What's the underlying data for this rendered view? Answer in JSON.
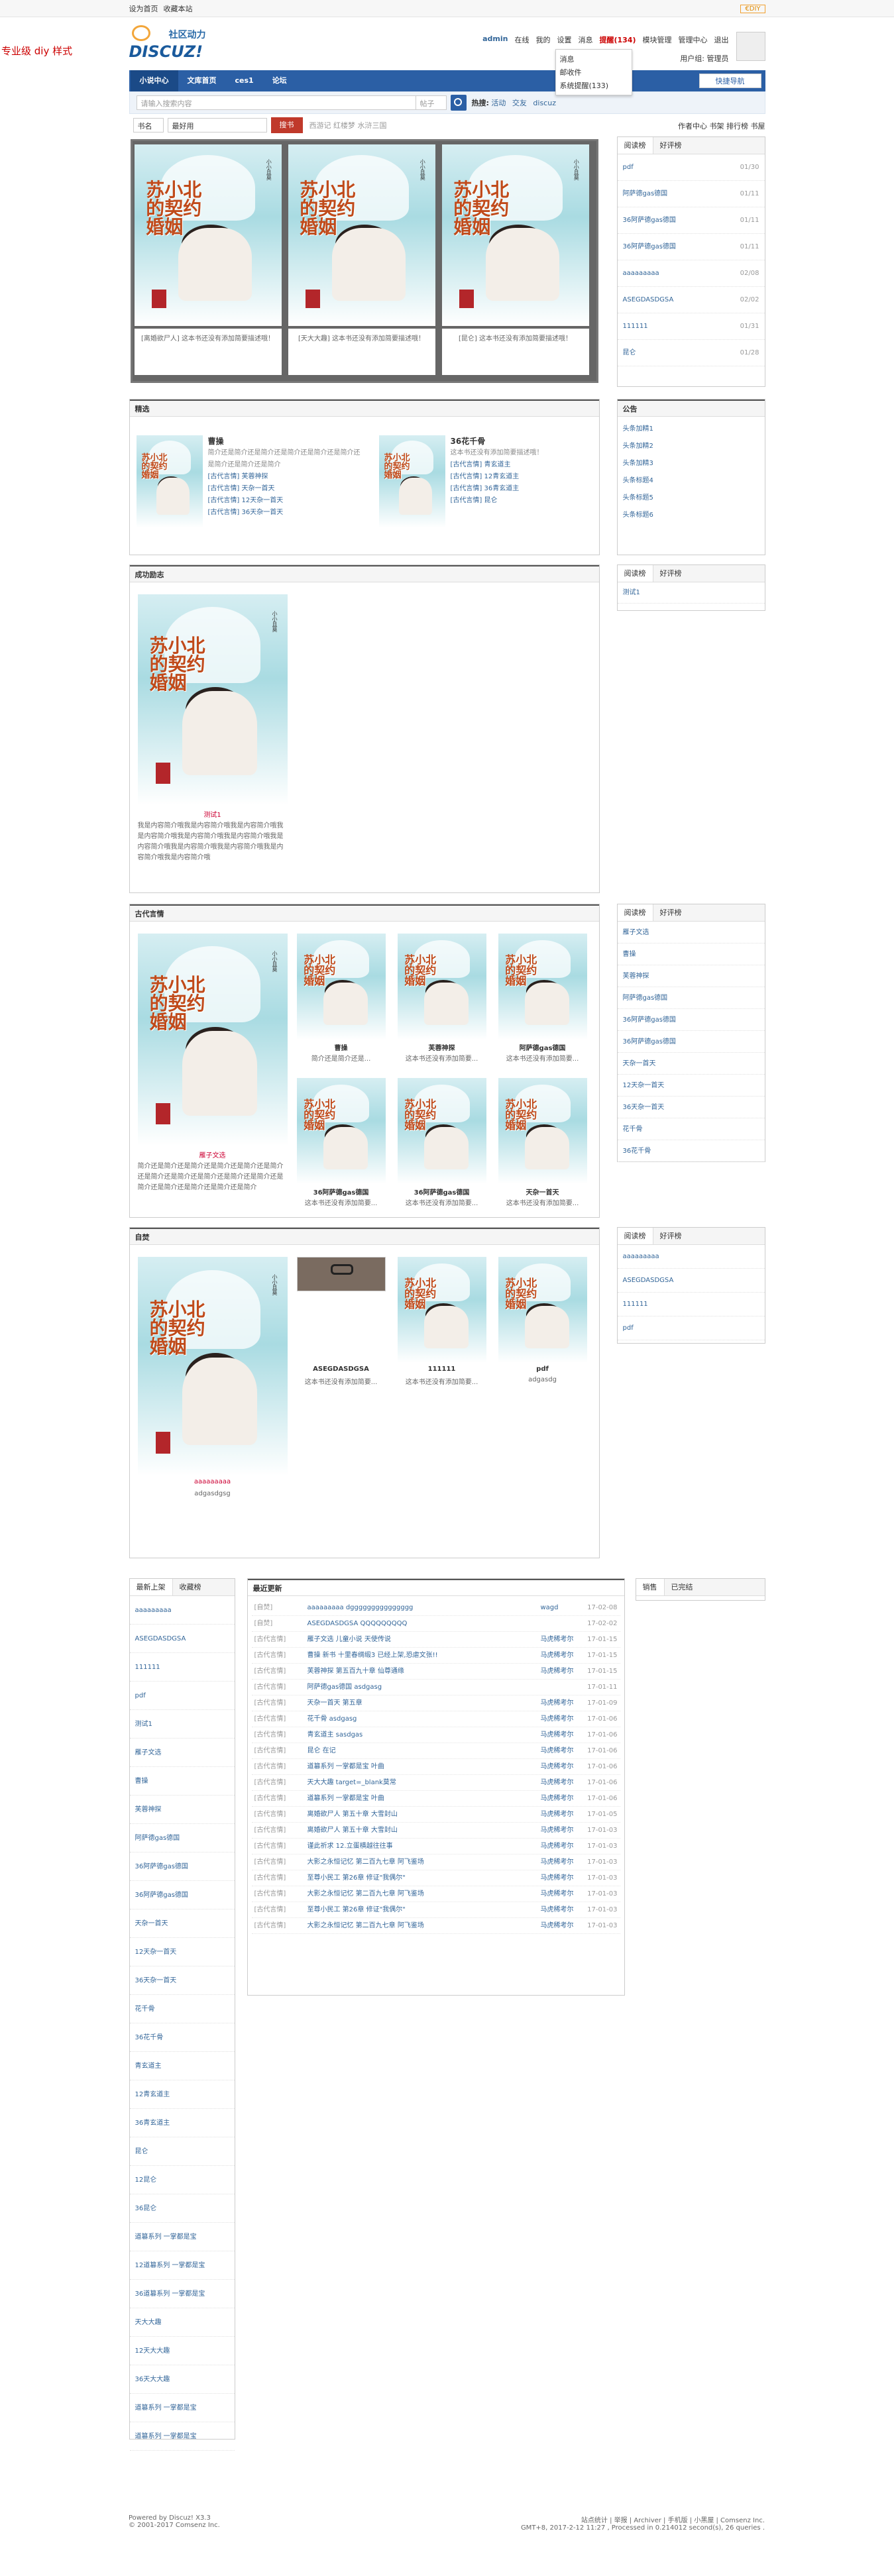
{
  "topbar": {
    "left": [
      "设为首页",
      "收藏本站"
    ],
    "right_badge": "€DIY"
  },
  "side_brand": "专业级 diy 样式",
  "logo": {
    "line1": "社区动力",
    "line2": "DISCUZ!"
  },
  "user_menu": {
    "items": [
      "admin",
      "在线",
      "我的",
      "设置",
      "消息",
      "提醒(134)",
      "模块管理",
      "管理中心",
      "退出"
    ],
    "line2": "用户组: 管理员"
  },
  "dropdown": {
    "items": [
      "消息",
      "邮收件",
      "系统提醒(133)"
    ]
  },
  "nav": {
    "items": [
      "小说中心",
      "文库首页",
      "ces1",
      "论坛"
    ],
    "quick": "快捷导航"
  },
  "search": {
    "placeholder": "请输入搜索内容",
    "scope": "帖子",
    "hot_label": "热搜:",
    "hot": [
      "活动",
      "交友",
      "discuz"
    ]
  },
  "bar2": {
    "field1": "书名",
    "field2": "最好用",
    "button": "搜书",
    "hints": "西游记 红楼梦 水浒三国",
    "right": "作者中心 书架 排行榜 书屋"
  },
  "slider": {
    "captions": [
      "[离婚欲尸人] 这本书还没有添加简要描述哦！",
      "[天大大趣] 这本书还没有添加简要描述哦！",
      "[昆仑] 这本书还没有添加简要描述哦！"
    ]
  },
  "rank1": {
    "tabs": [
      "阅读榜",
      "好评榜"
    ],
    "rows": [
      [
        "pdf",
        "01/30"
      ],
      [
        "阿萨德gas德国",
        "01/11"
      ],
      [
        "36阿萨德gas德国",
        "01/11"
      ],
      [
        "36阿萨德gas德国",
        "01/11"
      ],
      [
        "aaaaaaaaa",
        "02/08"
      ],
      [
        "ASEGDASDGSA",
        "02/02"
      ],
      [
        "111111",
        "01/31"
      ],
      [
        "昆仑",
        "01/28"
      ]
    ]
  },
  "featured": {
    "title": "精选",
    "books": [
      {
        "name": "曹操",
        "desc": "简介还是简介还是简介还是简介还是简介还是简介还是简介还是简介还是简介",
        "lines": [
          "[古代言情] 芙蓉神探",
          "[古代言情] 天杂一首天",
          "[古代言情] 12天杂一首天",
          "[古代言情] 36天杂一首天"
        ]
      },
      {
        "name": "36花千骨",
        "desc": "这本书还没有添加简要描述哦！",
        "lines": [
          "[古代言情] 青玄道主",
          "[古代言情] 12青玄道主",
          "[古代言情] 36青玄道主",
          "[古代言情] 昆仑"
        ]
      }
    ]
  },
  "notice": {
    "title": "公告",
    "items": [
      "头条加精1",
      "头条加精2",
      "头条加精3",
      "头条标题4",
      "头条标题5",
      "头条标题6"
    ]
  },
  "rank2": {
    "tabs": [
      "阅读榜",
      "好评榜"
    ],
    "rows": [
      [
        "测试1",
        ""
      ]
    ]
  },
  "success": {
    "title": "成功励志",
    "book": "测试1",
    "desc": "我是内容简介哦我是内容简介哦我是内容简介哦我是内容简介哦我是内容简介哦我是内容简介哦我是内容简介哦我是内容简介哦我是内容简介哦我是内容简介哦我是内容简介哦"
  },
  "ancient": {
    "title": "古代言情",
    "main": {
      "name": "雁子文选",
      "desc": "简介还是简介还是简介还是简介还是简介还是简介还是简介还是简介还是简介还是简介还是简介还是简介还是简介还是简介还是简介还是简介"
    },
    "grid": [
      [
        "曹操",
        "简介还是简介还是..."
      ],
      [
        "芙蓉神探",
        "这本书还没有添加简要..."
      ],
      [
        "阿萨德gas德国",
        "这本书还没有添加简要..."
      ],
      [
        "36阿萨德gas德国",
        "这本书还没有添加简要..."
      ],
      [
        "36阿萨德gas德国",
        "这本书还没有添加简要..."
      ],
      [
        "天杂一首天",
        "这本书还没有添加简要..."
      ]
    ]
  },
  "rank3": {
    "tabs": [
      "阅读榜",
      "好评榜"
    ],
    "rows": [
      "雁子文选",
      "曹操",
      "芙蓉神探",
      "阿萨德gas德国",
      "36阿萨德gas德国",
      "36阿萨德gas德国",
      "天杂一首天",
      "12天杂一首天",
      "36天杂一首天",
      "花千骨",
      "36花千骨"
    ]
  },
  "zibin": {
    "title": "自焚",
    "main": {
      "name": "aaaaaaaaa",
      "desc": "adgasdgsg"
    },
    "grid": [
      [
        "ASEGDASDGSA",
        "这本书还没有添加简要..."
      ],
      [
        "111111",
        "这本书还没有添加简要..."
      ],
      [
        "pdf",
        "adgasdg"
      ]
    ]
  },
  "rank4": {
    "tabs": [
      "阅读榜",
      "好评榜"
    ],
    "rows": [
      "aaaaaaaaa",
      "ASEGDASDGSA",
      "111111",
      "pdf"
    ]
  },
  "newbooks": {
    "tabs": [
      "最新上架",
      "收藏榜"
    ],
    "items": [
      "aaaaaaaaa",
      "ASEGDASDGSA",
      "111111",
      "pdf",
      "测试1",
      "雁子文选",
      "曹操",
      "芙蓉神探",
      "阿萨德gas德国",
      "36阿萨德gas德国",
      "36阿萨德gas德国",
      "天杂一首天",
      "12天杂一首天",
      "36天杂一首天",
      "花千骨",
      "36花千骨",
      "青玄道主",
      "12青玄道主",
      "36青玄道主",
      "昆仑",
      "12昆仑",
      "36昆仑",
      "道篡系列 一掌都是宝",
      "12道篡系列 一掌都是宝",
      "36道篡系列 一掌都是宝",
      "天大大趣",
      "12天大大趣",
      "36天大大趣",
      "道篡系列 一掌都是宝",
      "道篡系列 一掌都是宝"
    ]
  },
  "recent": {
    "title": "最近更新",
    "rows": [
      [
        "[自焚]",
        "aaaaaaaaa dggggggggggggggg",
        "wagd",
        "17-02-08"
      ],
      [
        "[自焚]",
        "ASEGDASDGSA QQQQQQQQQ",
        "",
        "17-02-02"
      ],
      [
        "[古代言情]",
        "雁子文选 儿童小说 天使传说",
        "马虎稀考尔",
        "17-01-15"
      ],
      [
        "[古代言情]",
        "曹操 新书 十里春绸缎3 已经上架,恐虐文张!!",
        "马虎稀考尔",
        "17-01-15"
      ],
      [
        "[古代言情]",
        "芙蓉神探 第五百九十章 仙尊通缘",
        "马虎稀考尔",
        "17-01-15"
      ],
      [
        "[古代言情]",
        "阿萨德gas德国 asdgasg",
        "",
        "17-01-11"
      ],
      [
        "[古代言情]",
        "天杂一首天 第五章",
        "马虎稀考尔",
        "17-01-09"
      ],
      [
        "[古代言情]",
        "花千骨 asdgasg",
        "马虎稀考尔",
        "17-01-06"
      ],
      [
        "[古代言情]",
        "青玄道主 sasdgas",
        "马虎稀考尔",
        "17-01-06"
      ],
      [
        "[古代言情]",
        "昆仑 在记",
        "马虎稀考尔",
        "17-01-06"
      ],
      [
        "[古代言情]",
        "道篡系列 一掌都是宝 叶曲",
        "马虎稀考尔",
        "17-01-06"
      ],
      [
        "[古代言情]",
        "天大大趣 target=_blank莫常",
        "马虎稀考尔",
        "17-01-06"
      ],
      [
        "[古代言情]",
        "道篡系列 一掌都是宝 叶曲",
        "马虎稀考尔",
        "17-01-06"
      ],
      [
        "[古代言情]",
        "离婚欲尸人 第五十章 大雪封山",
        "马虎稀考尔",
        "17-01-05"
      ],
      [
        "[古代言情]",
        "离婚欲尸人 第五十章 大雪封山",
        "马虎稀考尔",
        "17-01-03"
      ],
      [
        "[古代言情]",
        "谨此祈求 12.立蛋横越往往事",
        "马虎稀考尔",
        "17-01-03"
      ],
      [
        "[古代言情]",
        "大影之永恒记忆 第二百九七章 阿飞鉴场",
        "马虎稀考尔",
        "17-01-03"
      ],
      [
        "[古代言情]",
        "至尊小民工 第26章 修证\"我偶尔\"",
        "马虎稀考尔",
        "17-01-03"
      ],
      [
        "[古代言情]",
        "大影之永恒记忆 第二百九七章 阿飞鉴场",
        "马虎稀考尔",
        "17-01-03"
      ],
      [
        "[古代言情]",
        "至尊小民工 第26章 修证\"我偶尔\"",
        "马虎稀考尔",
        "17-01-03"
      ],
      [
        "[古代言情]",
        "大影之永恒记忆 第二百九七章 阿飞鉴场",
        "马虎稀考尔",
        "17-01-03"
      ]
    ]
  },
  "sales": {
    "tabs": [
      "销售",
      "已完结"
    ]
  },
  "footer": {
    "powered": "Powered by Discuz! X3.3",
    "copy": "© 2001-2017 Comsenz Inc.",
    "links": "站点统计 | 举报 | Archiver | 手机版 | 小黑屋 | Comsenz Inc.",
    "gmt": "GMT+8, 2017-2-12 11:27 , Processed in 0.214012 second(s), 26 queries ."
  }
}
